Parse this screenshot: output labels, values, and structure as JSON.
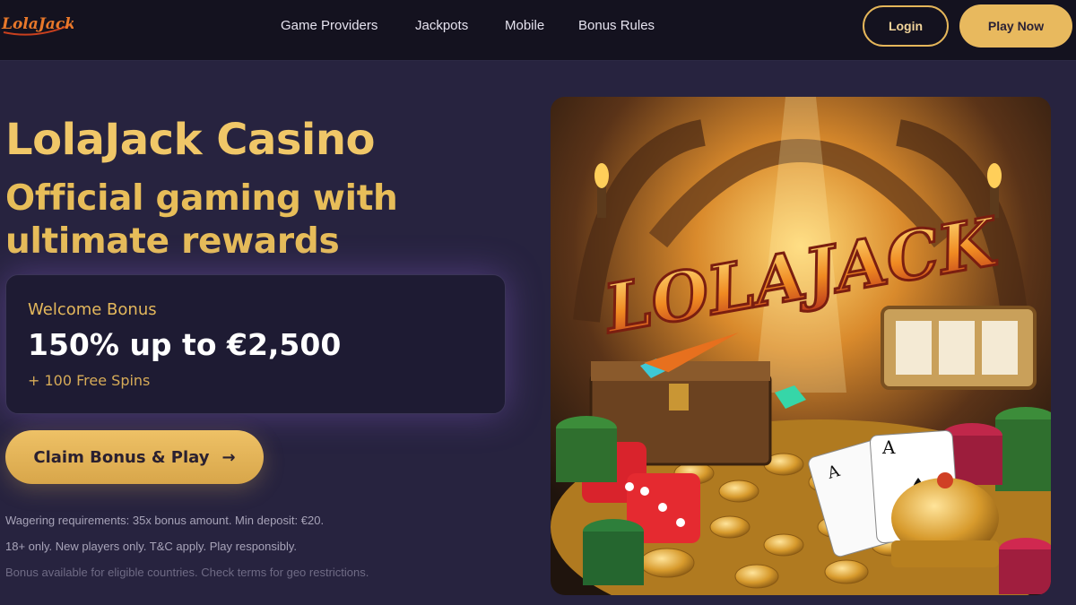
{
  "header": {
    "logo_text": "LolaJack",
    "nav": [
      "Game Providers",
      "Jackpots",
      "Mobile",
      "Bonus Rules"
    ],
    "login_label": "Login",
    "play_label": "Play Now"
  },
  "hero": {
    "title": "LolaJack Casino",
    "subtitle": "Official gaming with ultimate rewards"
  },
  "bonus": {
    "label": "Welcome Bonus",
    "amount": "150% up to €2,500",
    "extra": "+ 100 Free Spins"
  },
  "cta": {
    "label": "Claim Bonus & Play",
    "arrow": "→"
  },
  "fineprint": [
    "Wagering requirements: 35x bonus amount. Min deposit: €20.",
    "18+ only. New players only. T&C apply. Play responsibly.",
    "Bonus available for eligible countries. Check terms for geo restrictions."
  ],
  "art": {
    "logo_text": "LOLAJACK",
    "card_rank": "A"
  },
  "colors": {
    "accent_gold": "#e8b95e",
    "background": "#27233f",
    "header_bg": "#14121f",
    "card_bg": "#1e1b33"
  }
}
